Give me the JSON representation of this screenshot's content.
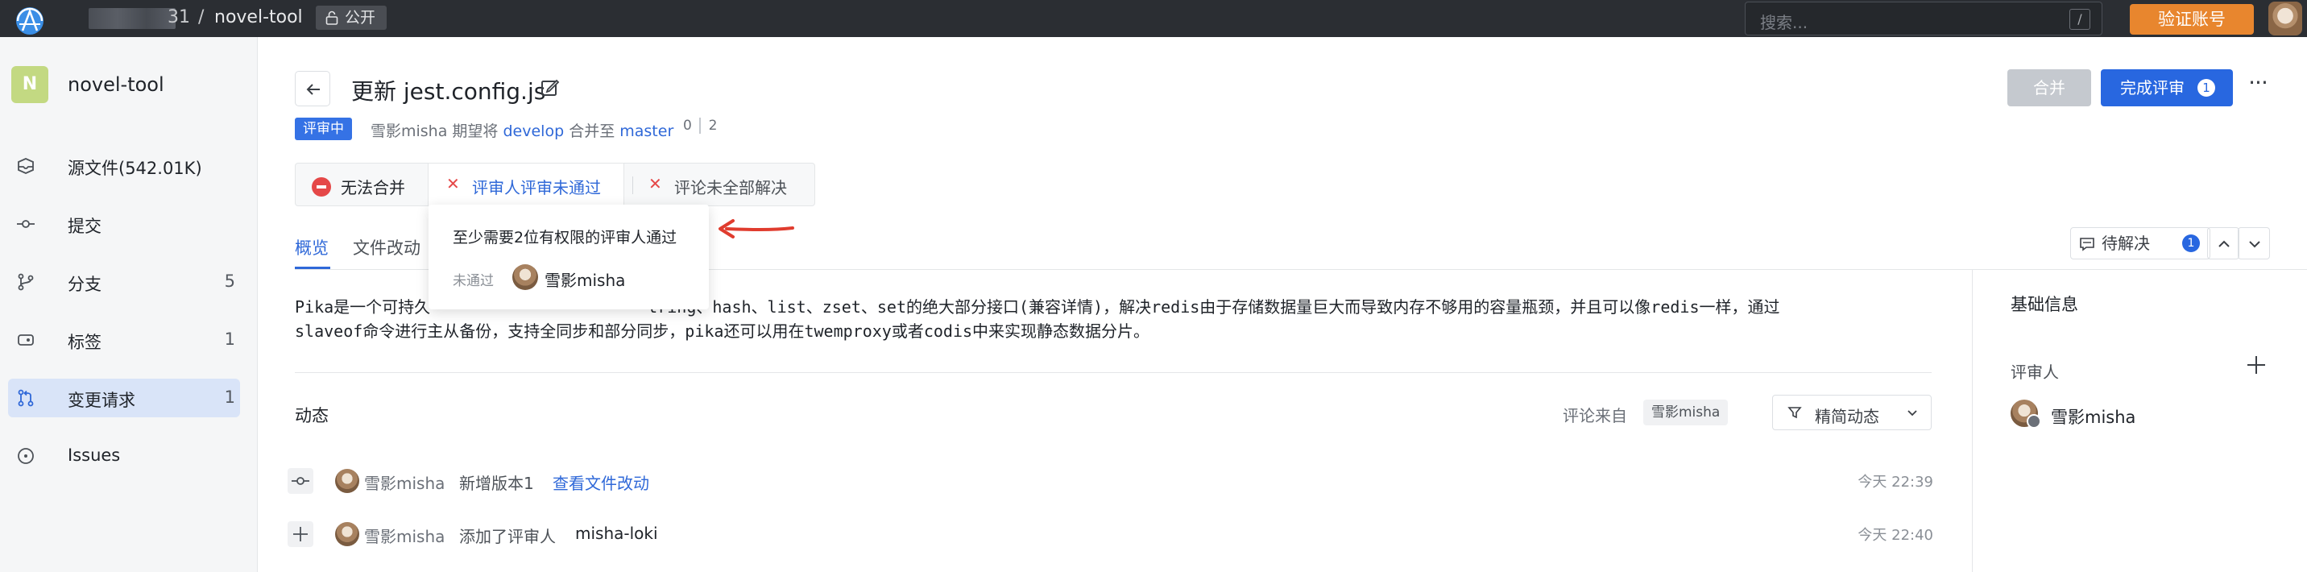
{
  "topbar": {
    "owner_suffix": "31",
    "separator": "/",
    "repo": "novel-tool",
    "visibility": "公开",
    "search_placeholder": "搜索...",
    "search_shortcut": "/",
    "verify_label": "验证账号"
  },
  "sidebar": {
    "repo_initial": "N",
    "repo_name": "novel-tool",
    "items": [
      {
        "label": "源文件(542.01K)",
        "icon": "source-icon",
        "count": ""
      },
      {
        "label": "提交",
        "icon": "commit-icon",
        "count": ""
      },
      {
        "label": "分支",
        "icon": "branch-icon",
        "count": "5"
      },
      {
        "label": "标签",
        "icon": "tag-icon",
        "count": "1"
      },
      {
        "label": "变更请求",
        "icon": "merge-request-icon",
        "count": "1"
      },
      {
        "label": "Issues",
        "icon": "issues-icon",
        "count": ""
      }
    ],
    "active_index": 4
  },
  "mr": {
    "title": "更新 jest.config.js",
    "status": "评审中",
    "author": "雪影misha",
    "desc_mid": "期望将",
    "source_branch": "develop",
    "desc_merge": "合并至",
    "target_branch": "master",
    "commits": "0",
    "commits_b": "2",
    "merge_label": "合并",
    "finish_label": "完成评审",
    "finish_count": "1"
  },
  "checks": {
    "cannot_merge": "无法合并",
    "reviewer_not_passed": "评审人评审未通过",
    "comments_unresolved": "评论未全部解决"
  },
  "popup": {
    "title": "至少需要2位有权限的评审人通过",
    "status": "未通过",
    "user": "雪影misha"
  },
  "tabs": {
    "overview": "概览",
    "file_changes": "文件改动",
    "pending_label": "待解决",
    "pending_count": "1"
  },
  "description": {
    "line1_start": "Pika是一个可持久",
    "line1_end": "tring、hash、list、zset、set的绝大部分接口(兼容详情)，解决redis由于存储数据量巨大而导致内存不够用的容量瓶颈，并且可以像redis一样，通过",
    "line2_start": "slaveof命令进行主从备份，",
    "line2_end": "支持全同步和部分同步，pika还可以用在twemproxy或者codis中来实现静态数据分片。"
  },
  "activity": {
    "title": "动态",
    "comments_from": "评论来自",
    "chip_user": "雪影misha",
    "filter_label": "精简动态",
    "rows": [
      {
        "user": "雪影misha",
        "action": "新增版本1",
        "link": "查看文件改动",
        "target": "",
        "time": "今天 22:39"
      },
      {
        "user": "雪影misha",
        "action": "添加了评审人",
        "link": "",
        "target": "misha-loki",
        "time": "今天 22:40"
      }
    ]
  },
  "right_panel": {
    "title": "基础信息",
    "reviewers_label": "评审人",
    "reviewer": "雪影misha"
  },
  "colors": {
    "accent": "#2867e0",
    "link": "#2f68d8",
    "danger": "#e54848",
    "verify": "#e8862e",
    "topbar": "#2b2e33"
  }
}
